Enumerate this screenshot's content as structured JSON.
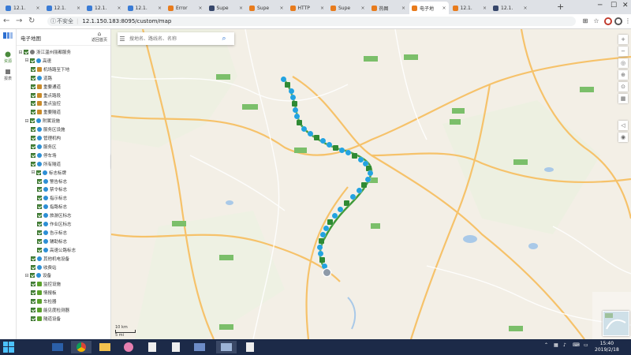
{
  "browser": {
    "tabs": [
      {
        "label": "12.1.",
        "color": "#3a7bd5",
        "active": false
      },
      {
        "label": "12.1.",
        "color": "#3a7bd5",
        "active": false
      },
      {
        "label": "12.1.",
        "color": "#3a7bd5",
        "active": false
      },
      {
        "label": "12.1.",
        "color": "#3a7bd5",
        "active": false
      },
      {
        "label": "Error",
        "color": "#e87b1c",
        "active": false
      },
      {
        "label": "Supe",
        "color": "#37476b",
        "active": false
      },
      {
        "label": "Supe",
        "color": "#e87b1c",
        "active": false
      },
      {
        "label": "HTTP",
        "color": "#e87b1c",
        "active": false
      },
      {
        "label": "Supe",
        "color": "#e87b1c",
        "active": false
      },
      {
        "label": "热图",
        "color": "#e87b1c",
        "active": false
      },
      {
        "label": "电子地",
        "color": "#e87b1c",
        "active": true
      },
      {
        "label": "12.1.",
        "color": "#e87b1c",
        "active": false
      },
      {
        "label": "12.1.",
        "color": "#37476b",
        "active": false
      }
    ],
    "insecure_label": "不安全",
    "url": "12.1.150.183:8095/custom/map"
  },
  "rail": {
    "items": [
      {
        "label": "资源"
      },
      {
        "label": "报表"
      }
    ]
  },
  "sidebar": {
    "title": "电子地图",
    "back_label": "返回首页",
    "tree": [
      {
        "label": "浙江温州丽都服务",
        "depth": 0,
        "icon": "#7a7a7a",
        "expander": "⊟"
      },
      {
        "label": "高速",
        "depth": 1,
        "icon": "#2d8fd5",
        "expander": "⊟"
      },
      {
        "label": "机场路至下地",
        "depth": 2,
        "icon": "#c98a2a"
      },
      {
        "label": "道路",
        "depth": 2,
        "icon": "#2d8fd5"
      },
      {
        "label": "重要通道",
        "depth": 2,
        "icon": "#c98a2a"
      },
      {
        "label": "重点路段",
        "depth": 2,
        "icon": "#c98a2a"
      },
      {
        "label": "重点监控",
        "depth": 2,
        "icon": "#c98a2a"
      },
      {
        "label": "重要隧道",
        "depth": 2,
        "icon": "#c98a2a"
      },
      {
        "label": "附属设施",
        "depth": 1,
        "icon": "#2d8fd5",
        "expander": "⊟"
      },
      {
        "label": "服务区设施",
        "depth": 2,
        "icon": "#2d8fd5"
      },
      {
        "label": "管理机构",
        "depth": 2,
        "icon": "#2d8fd5"
      },
      {
        "label": "服务区",
        "depth": 2,
        "icon": "#2d8fd5"
      },
      {
        "label": "停车场",
        "depth": 2,
        "icon": "#2d8fd5"
      },
      {
        "label": "所有隧道",
        "depth": 2,
        "icon": "#2d8fd5"
      },
      {
        "label": "标志标牌",
        "depth": 2,
        "icon": "#2d8fd5",
        "expander": "⊟"
      },
      {
        "label": "警告标志",
        "depth": 3,
        "icon": "#2d8fd5"
      },
      {
        "label": "禁令标志",
        "depth": 3,
        "icon": "#2d8fd5"
      },
      {
        "label": "指示标志",
        "depth": 3,
        "icon": "#2d8fd5"
      },
      {
        "label": "指路标志",
        "depth": 3,
        "icon": "#2d8fd5"
      },
      {
        "label": "旅游区标志",
        "depth": 3,
        "icon": "#2d8fd5"
      },
      {
        "label": "作业区标志",
        "depth": 3,
        "icon": "#2d8fd5"
      },
      {
        "label": "告示标志",
        "depth": 3,
        "icon": "#2d8fd5"
      },
      {
        "label": "辅助标志",
        "depth": 3,
        "icon": "#2d8fd5"
      },
      {
        "label": "高速公路标志",
        "depth": 3,
        "icon": "#2d8fd5"
      },
      {
        "label": "其他机电设备",
        "depth": 2,
        "icon": "#2d8fd5"
      },
      {
        "label": "收费站",
        "depth": 2,
        "icon": "#2d8fd5"
      },
      {
        "label": "设备",
        "depth": 1,
        "icon": "#2d8fd5",
        "expander": "⊟"
      },
      {
        "label": "监控设施",
        "depth": 2,
        "icon": "#5aa02c"
      },
      {
        "label": "情报板",
        "depth": 2,
        "icon": "#5aa02c"
      },
      {
        "label": "车检器",
        "depth": 2,
        "icon": "#5aa02c"
      },
      {
        "label": "能见度检测器",
        "depth": 2,
        "icon": "#5aa02c"
      },
      {
        "label": "隧道设备",
        "depth": 2,
        "icon": "#5aa02c"
      }
    ]
  },
  "map": {
    "search_placeholder": "搜地名、路线名、名称",
    "scale_top": "10 km",
    "scale_bottom": "5 mi",
    "tools": [
      "+",
      "−",
      "◎",
      "⊕",
      "⊙",
      "▦",
      "◁",
      "◉"
    ]
  },
  "taskbar": {
    "time": "15:40",
    "date": "2019/2/18"
  }
}
